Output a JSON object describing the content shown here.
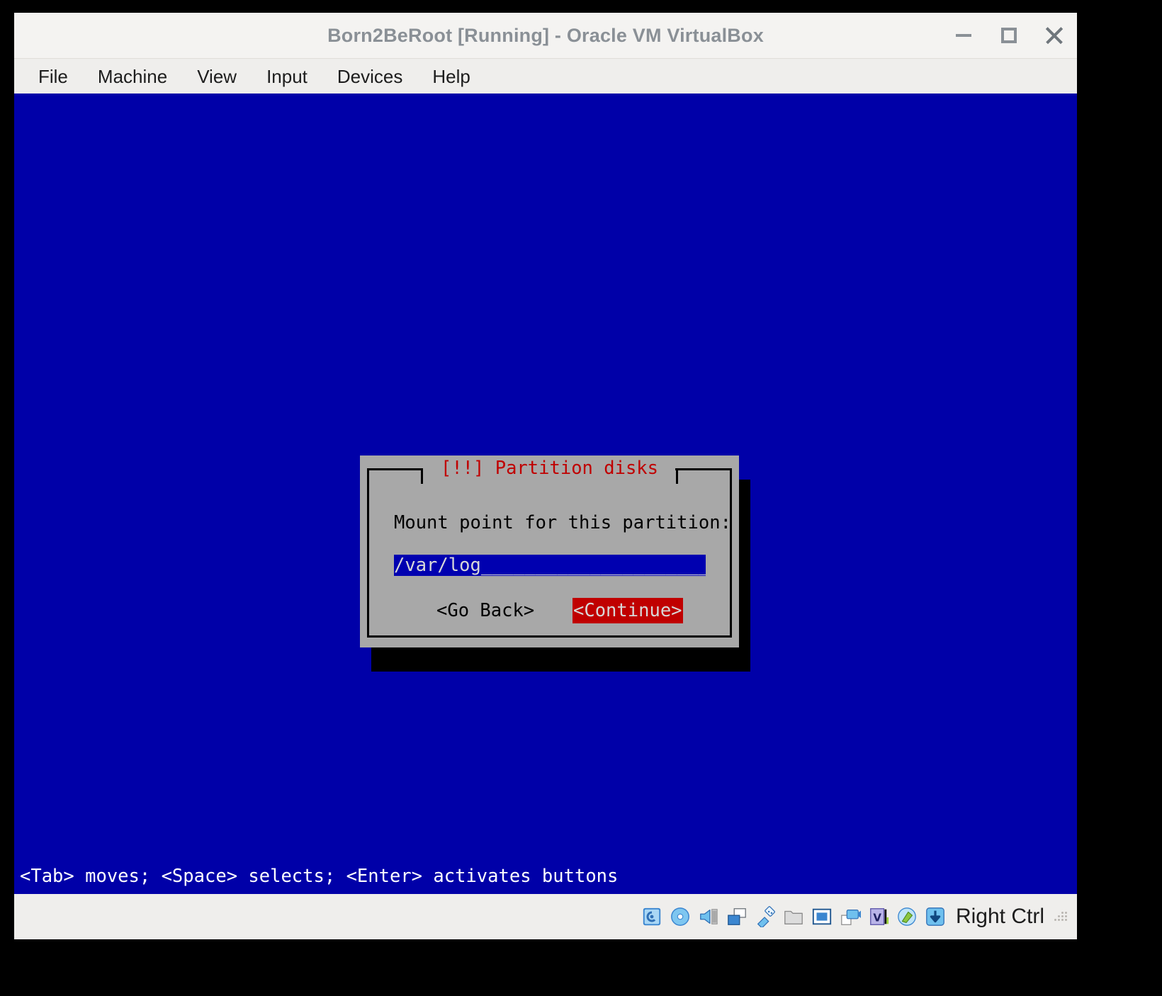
{
  "window": {
    "title": "Born2BeRoot [Running] - Oracle VM VirtualBox",
    "controls": {
      "minimize": "minimize-icon",
      "maximize": "maximize-icon",
      "close": "close-icon"
    }
  },
  "menubar": {
    "items": [
      {
        "label": "File"
      },
      {
        "label": "Machine"
      },
      {
        "label": "View"
      },
      {
        "label": "Input"
      },
      {
        "label": "Devices"
      },
      {
        "label": "Help"
      }
    ]
  },
  "guest": {
    "background_color": "#0000a8",
    "dialog": {
      "title": "[!!] Partition disks",
      "title_color": "#c00000",
      "background_color": "#a8a8a8",
      "prompt": "Mount point for this partition:",
      "input": {
        "value": "/var/log",
        "filler": "____________________________",
        "display": "/var/log____________________________",
        "background_color": "#0000b0",
        "text_color": "#d8d8d8"
      },
      "buttons": [
        {
          "label": "<Go Back>",
          "selected": false
        },
        {
          "label": "<Continue>",
          "selected": true,
          "highlight_color": "#c00000"
        }
      ]
    },
    "status_line": "<Tab> moves; <Space> selects; <Enter> activates buttons",
    "status_color": "#ffffff"
  },
  "statusbar": {
    "icons": [
      {
        "name": "hard-disk-icon"
      },
      {
        "name": "optical-disk-icon"
      },
      {
        "name": "audio-icon"
      },
      {
        "name": "network-icon"
      },
      {
        "name": "usb-icon"
      },
      {
        "name": "shared-folder-icon"
      },
      {
        "name": "display-icon"
      },
      {
        "name": "video-capture-icon"
      },
      {
        "name": "virtualization-chip-icon"
      },
      {
        "name": "mouse-integration-icon"
      },
      {
        "name": "host-key-icon"
      }
    ],
    "host_key": "Right Ctrl"
  }
}
